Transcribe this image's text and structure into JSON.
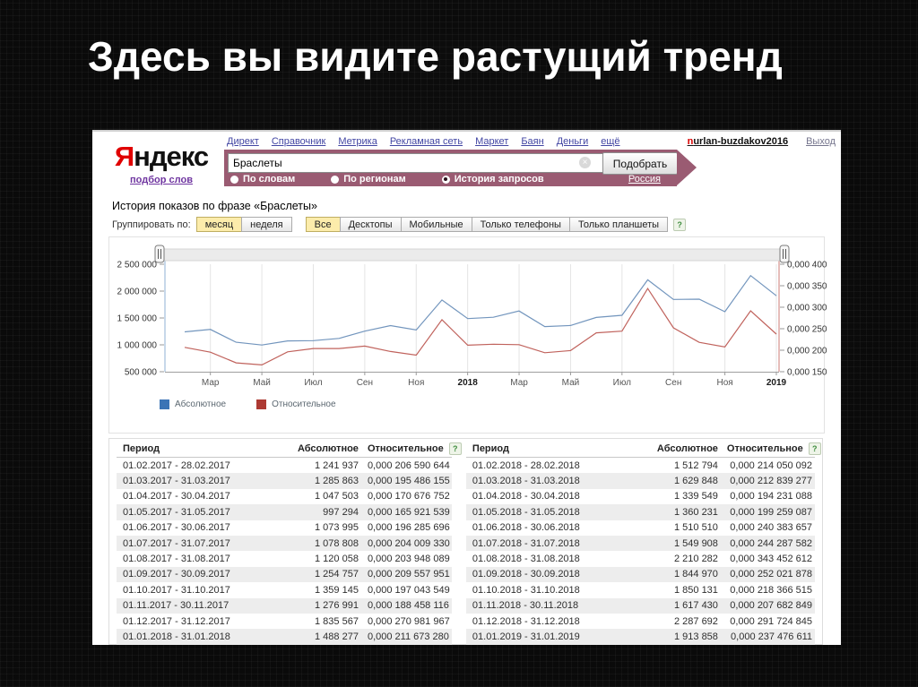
{
  "slide": {
    "title": "Здесь вы видите растущий тренд"
  },
  "ui": {
    "help_badge": "?"
  },
  "nav": {
    "links": [
      "Директ",
      "Справочник",
      "Метрика",
      "Рекламная сеть",
      "Маркет",
      "Баян",
      "Деньги",
      "ещё"
    ],
    "user_first": "n",
    "user_rest": "urlan-buzdakov2016",
    "logout": "Выход"
  },
  "logo": {
    "first_letter": "Я",
    "rest": "ндекс",
    "sub_link": "подбор слов"
  },
  "search": {
    "query": "Браслеты",
    "clear_icon": "×",
    "submit_label": "Подобрать",
    "radios": [
      {
        "label": "По словам",
        "selected": false
      },
      {
        "label": "По регионам",
        "selected": false
      },
      {
        "label": "История запросов",
        "selected": true
      }
    ],
    "region": "Россия"
  },
  "page": {
    "heading": "История показов по фразе «Браслеты»"
  },
  "filters": {
    "group_by_label": "Группировать по:",
    "group_by": [
      {
        "label": "месяц",
        "active": true
      },
      {
        "label": "неделя",
        "active": false
      }
    ],
    "device_tabs": [
      {
        "label": "Все",
        "active": true
      },
      {
        "label": "Десктопы",
        "active": false
      },
      {
        "label": "Мобильные",
        "active": false
      },
      {
        "label": "Только телефоны",
        "active": false
      },
      {
        "label": "Только планшеты",
        "active": false
      }
    ]
  },
  "chart_data": {
    "type": "line",
    "x_tick_labels": [
      "Мар",
      "Май",
      "Июл",
      "Сен",
      "Ноя",
      "2018",
      "Мар",
      "Май",
      "Июл",
      "Сен",
      "Ноя",
      "2019"
    ],
    "left_axis": {
      "ticks": [
        "2 500 000",
        "2 000 000",
        "1 500 000",
        "1 000 000",
        "500 000"
      ],
      "min": 500000,
      "max": 2500000
    },
    "right_axis": {
      "ticks": [
        "0,000 400",
        "0,000 350",
        "0,000 300",
        "0,000 250",
        "0,000 200",
        "0,000 150"
      ],
      "min": 0.00015,
      "max": 0.0004
    },
    "grid": "vertical-only",
    "legend_position": "bottom-left",
    "series": [
      {
        "name": "Абсолютное",
        "axis": "left",
        "color": "#7295bd",
        "legend_color": "#3b74b6",
        "values": [
          1241937,
          1285863,
          1047503,
          997294,
          1073995,
          1078808,
          1120058,
          1254757,
          1359145,
          1276991,
          1835567,
          1488277,
          1512794,
          1629848,
          1339549,
          1360231,
          1510510,
          1549908,
          2210282,
          1844970,
          1850131,
          1617430,
          2287692,
          1913858
        ]
      },
      {
        "name": "Относительное",
        "axis": "right",
        "color": "#c0625c",
        "legend_color": "#ad3a33",
        "values": [
          0.000206590644,
          0.000195486155,
          0.000170676752,
          0.000165921539,
          0.000196285696,
          0.00020400933,
          0.000203948089,
          0.000209557951,
          0.000197043549,
          0.000188458116,
          0.000270981967,
          0.00021167328,
          0.000214050092,
          0.000212839277,
          0.000194231088,
          0.000199259087,
          0.000240383657,
          0.000244287582,
          0.000343452612,
          0.000252021878,
          0.000218366515,
          0.000207682849,
          0.000291724845,
          0.000237476611
        ]
      }
    ]
  },
  "tables": {
    "headers": [
      "Период",
      "Абсолютное",
      "Относительное"
    ],
    "left": {
      "rows": [
        [
          "01.02.2017 - 28.02.2017",
          "1 241 937",
          "0,000 206 590 644"
        ],
        [
          "01.03.2017 - 31.03.2017",
          "1 285 863",
          "0,000 195 486 155"
        ],
        [
          "01.04.2017 - 30.04.2017",
          "1 047 503",
          "0,000 170 676 752"
        ],
        [
          "01.05.2017 - 31.05.2017",
          "997 294",
          "0,000 165 921 539"
        ],
        [
          "01.06.2017 - 30.06.2017",
          "1 073 995",
          "0,000 196 285 696"
        ],
        [
          "01.07.2017 - 31.07.2017",
          "1 078 808",
          "0,000 204 009 330"
        ],
        [
          "01.08.2017 - 31.08.2017",
          "1 120 058",
          "0,000 203 948 089"
        ],
        [
          "01.09.2017 - 30.09.2017",
          "1 254 757",
          "0,000 209 557 951"
        ],
        [
          "01.10.2017 - 31.10.2017",
          "1 359 145",
          "0,000 197 043 549"
        ],
        [
          "01.11.2017 - 30.11.2017",
          "1 276 991",
          "0,000 188 458 116"
        ],
        [
          "01.12.2017 - 31.12.2017",
          "1 835 567",
          "0,000 270 981 967"
        ],
        [
          "01.01.2018 - 31.01.2018",
          "1 488 277",
          "0,000 211 673 280"
        ]
      ]
    },
    "right": {
      "rows": [
        [
          "01.02.2018 - 28.02.2018",
          "1 512 794",
          "0,000 214 050 092"
        ],
        [
          "01.03.2018 - 31.03.2018",
          "1 629 848",
          "0,000 212 839 277"
        ],
        [
          "01.04.2018 - 30.04.2018",
          "1 339 549",
          "0,000 194 231 088"
        ],
        [
          "01.05.2018 - 31.05.2018",
          "1 360 231",
          "0,000 199 259 087"
        ],
        [
          "01.06.2018 - 30.06.2018",
          "1 510 510",
          "0,000 240 383 657"
        ],
        [
          "01.07.2018 - 31.07.2018",
          "1 549 908",
          "0,000 244 287 582"
        ],
        [
          "01.08.2018 - 31.08.2018",
          "2 210 282",
          "0,000 343 452 612"
        ],
        [
          "01.09.2018 - 30.09.2018",
          "1 844 970",
          "0,000 252 021 878"
        ],
        [
          "01.10.2018 - 31.10.2018",
          "1 850 131",
          "0,000 218 366 515"
        ],
        [
          "01.11.2018 - 30.11.2018",
          "1 617 430",
          "0,000 207 682 849"
        ],
        [
          "01.12.2018 - 31.12.2018",
          "2 287 692",
          "0,000 291 724 845"
        ],
        [
          "01.01.2019 - 31.01.2019",
          "1 913 858",
          "0,000 237 476 611"
        ]
      ]
    }
  }
}
